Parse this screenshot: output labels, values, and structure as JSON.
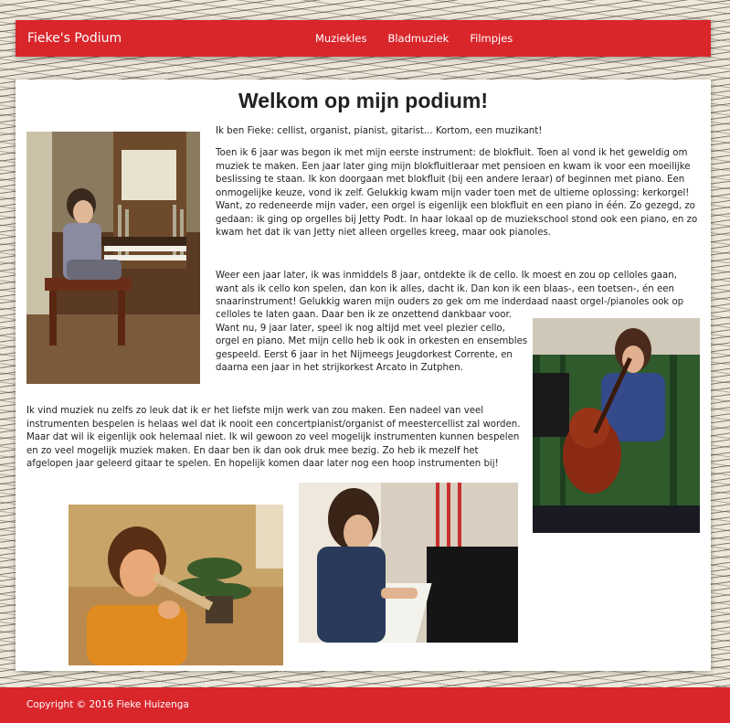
{
  "navbar": {
    "brand": "Fieke's Podium",
    "links": [
      "Muziekles",
      "Bladmuziek",
      "Filmpjes"
    ]
  },
  "main": {
    "title": "Welkom op mijn podium!",
    "intro": "Ik ben Fieke: cellist, organist, pianist, gitarist... Kortom, een muzikant!",
    "paragraph1": "Toen ik 6 jaar was begon ik met mijn eerste instrument: de blokfluit. Toen al vond ik het geweldig om muziek te maken. Een jaar later ging mijn blokfluitleraar met pensioen en kwam ik voor een moeilijke beslissing te staan. Ik kon doorgaan met blokfluit (bij een andere leraar) of beginnen met piano. Een onmogelijke keuze, vond ik zelf. Gelukkig kwam mijn vader toen met de ultieme oplossing: kerkorgel! Want, zo redeneerde mijn vader, een orgel is eigenlijk een blokfluit en een piano in één. Zo gezegd, zo gedaan: ik ging op orgelles bij Jetty Podt. In haar lokaal op de muziekschool stond ook een piano, en zo kwam het dat ik van Jetty niet alleen orgelles kreeg, maar ook pianoles.",
    "paragraph2_top": "Weer een jaar later, ik was inmiddels 8 jaar, ontdekte ik de cello. Ik moest en zou op celloles gaan, want als ik cello kon spelen, dan kon ik alles, dacht ik. Dan kon ik een blaas-, een toetsen-, én een snaarinstrument! Gelukkig waren mijn ouders zo gek om me inderdaad naast orgel-/pianoles ook op",
    "paragraph2_bottom": "celloles te laten gaan. Daar ben ik ze onzettend dankbaar voor. Want nu, 9 jaar later, speel ik nog altijd met veel plezier cello, orgel en piano. Met mijn cello heb ik ook in orkesten en ensembles gespeeld. Eerst 6 jaar in het Nijmeegs Jeugdorkest Corrente, en daarna een jaar in het strijkorkest Arcato in Zutphen.",
    "paragraph3": "Ik vind muziek nu zelfs zo leuk dat ik er het liefste mijn werk van zou maken. Een nadeel van veel instrumenten bespelen is helaas wel dat ik nooit een concertpianist/organist of meestercellist zal worden. Maar dat wil ik eigenlijk ook helemaal niet. Ik wil gewoon zo veel mogelijk instrumenten kunnen bespelen en zo veel mogelijk muziek maken. En daar ben ik dan ook druk mee bezig. Zo heb ik mezelf het afgelopen jaar geleerd gitaar te spelen. En hopelijk komen daar later nog een hoop instrumenten bij!"
  },
  "footer": {
    "copyright": "Copyright © 2016 Fieke Huizenga"
  },
  "colors": {
    "accent": "#d9262b"
  }
}
